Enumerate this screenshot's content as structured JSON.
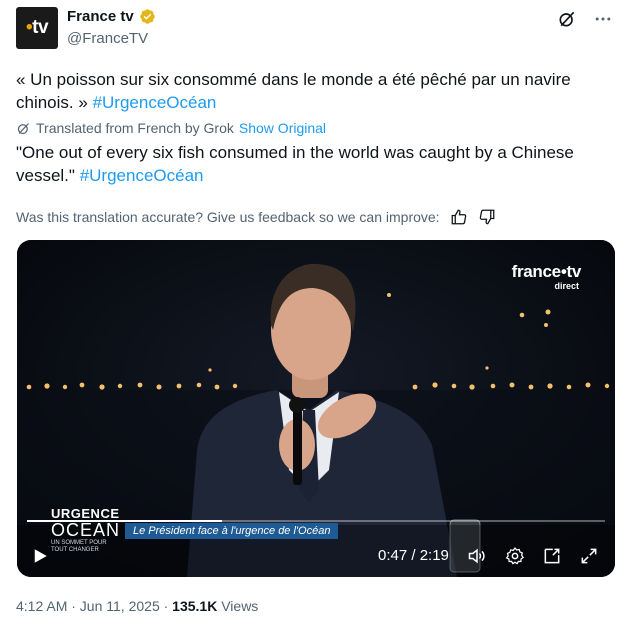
{
  "author": {
    "display_name": "France tv",
    "handle": "@FranceTV",
    "avatar_logo": "tv",
    "verified": true,
    "badge_color": "#e2b719"
  },
  "tweet": {
    "original_text": "« Un poisson sur six consommé dans le monde a été pêché par un navire chinois. »",
    "original_hashtag": "#UrgenceOcéan",
    "translated_note": "Translated from French by Grok",
    "show_original": "Show Original",
    "translated_text": "\"One out of every six fish consumed in the world was caught by a Chinese vessel.\"",
    "translated_hashtag": "#UrgenceOcéan",
    "feedback_prompt": "Was this translation accurate? Give us feedback so we can improve:"
  },
  "video": {
    "channel_brand": "france•tv",
    "channel_sub": "direct",
    "show_line1": "URGENCE",
    "show_line2": "OCÉAN",
    "show_line3": "UN SOMMET POUR TOUT CHANGER",
    "lower_third": "Le Président face à l'urgence de l'Océan",
    "time_display": "0:47 / 2:19",
    "progress_fraction": 0.338
  },
  "meta": {
    "timestamp": "4:12 AM · Jun 11, 2025 · ",
    "views_count": "135.1K",
    "views_label": " Views"
  },
  "colors": {
    "accent": "#1d9bf0",
    "muted": "#536471",
    "brand_orange": "#f0a000"
  }
}
